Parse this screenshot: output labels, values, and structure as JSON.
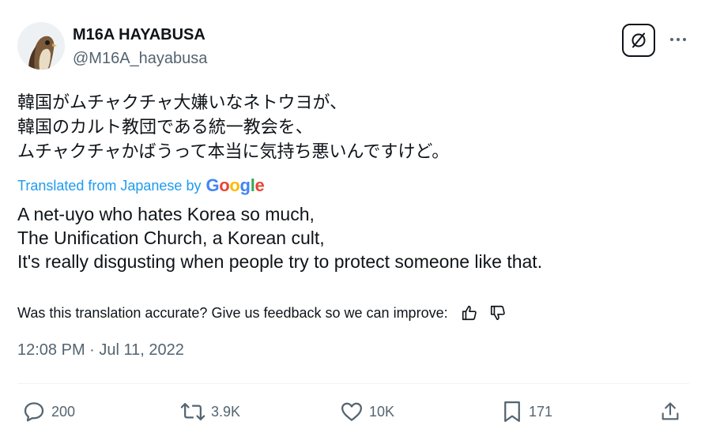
{
  "author": {
    "display_name": "M16A HAYABUSA",
    "handle": "@M16A_hayabusa",
    "avatar_icon": "falcon-avatar"
  },
  "buttons": {
    "grok_icon": "grok-icon",
    "more_icon": "more-dots-icon"
  },
  "post": {
    "text_original": "韓国がムチャクチャ大嫌いなネトウヨが、\n韓国のカルト教団である統一教会を、\nムチャクチャかばうって本当に気持ち悪いんですけど。",
    "translated_label": "Translated from Japanese by",
    "translator": "Google",
    "text_translated": "A net-uyo who hates Korea so much,\nThe Unification Church, a Korean cult,\nIt's really disgusting when people try to protect someone like that.",
    "feedback_prompt": "Was this translation accurate? Give us feedback so we can improve:",
    "timestamp": "12:08 PM · Jul 11, 2022"
  },
  "actions": {
    "replies": "200",
    "reposts": "3.9K",
    "likes": "10K",
    "bookmarks": "171"
  },
  "colors": {
    "text": "#0f1419",
    "secondary": "#536471",
    "link": "#1d9bf0",
    "divider": "#eff3f4",
    "google_blue": "#4285f4",
    "google_red": "#ea4335",
    "google_yellow": "#fbbc05",
    "google_green": "#34a853"
  }
}
